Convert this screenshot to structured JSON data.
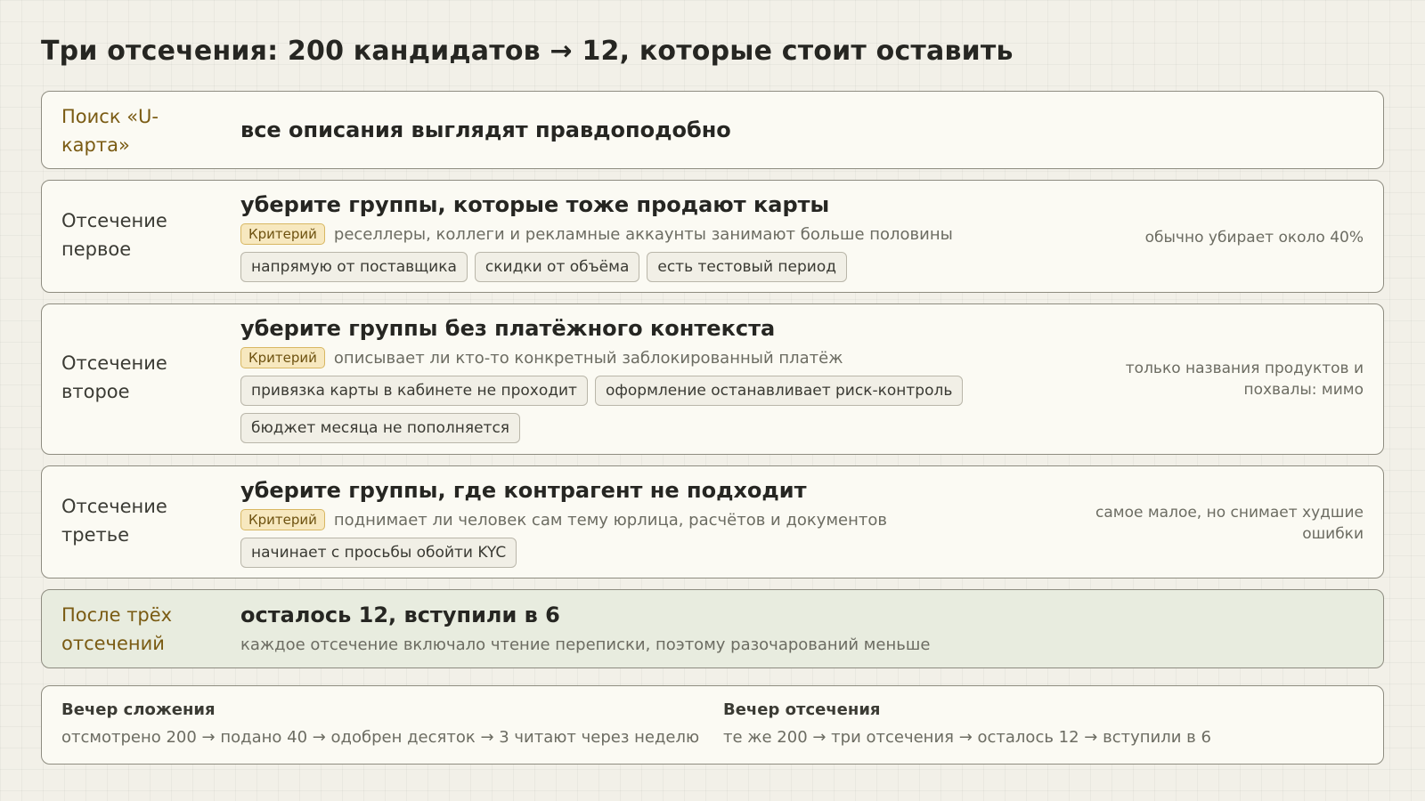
{
  "title": "Три отсечения: 200 кандидатов → 12, которые стоит оставить",
  "search": {
    "label": "Поиск «U-карта»",
    "headline": "все описания выглядят правдоподобно"
  },
  "cuts": [
    {
      "label": "Отсечение первое",
      "headline": "уберите группы, которые тоже продают карты",
      "criterion_badge": "Критерий",
      "criterion": "реселлеры, коллеги и рекламные аккаунты занимают больше половины",
      "tags": [
        "напрямую от поставщика",
        "скидки от объёма",
        "есть тестовый период"
      ],
      "note": "обычно убирает около 40%"
    },
    {
      "label": "Отсечение второе",
      "headline": "уберите группы без платёжного контекста",
      "criterion_badge": "Критерий",
      "criterion": "описывает ли кто-то конкретный заблокированный платёж",
      "tags": [
        "привязка карты в кабинете не проходит",
        "оформление останавливает риск-контроль",
        "бюджет месяца не пополняется"
      ],
      "note": "только названия продуктов и похвалы: мимо"
    },
    {
      "label": "Отсечение третье",
      "headline": "уберите группы, где контрагент не подходит",
      "criterion_badge": "Критерий",
      "criterion": "поднимает ли человек сам тему юрлица, расчётов и документов",
      "tags": [
        "начинает с просьбы обойти KYC"
      ],
      "note": "самое малое, но снимает худшие ошибки"
    }
  ],
  "result": {
    "label": "После трёх отсечений",
    "headline": "осталось 12, вступили в 6",
    "sub": "каждое отсечение включало чтение переписки, поэтому разочарований меньше"
  },
  "comparison": {
    "left_title": "Вечер сложения",
    "left_text": "отсмотрено 200 → подано 40 → одобрен десяток → 3 читают через неделю",
    "right_title": "Вечер отсечения",
    "right_text": "те же 200 → три отсечения → осталось 12 → вступили в 6"
  }
}
